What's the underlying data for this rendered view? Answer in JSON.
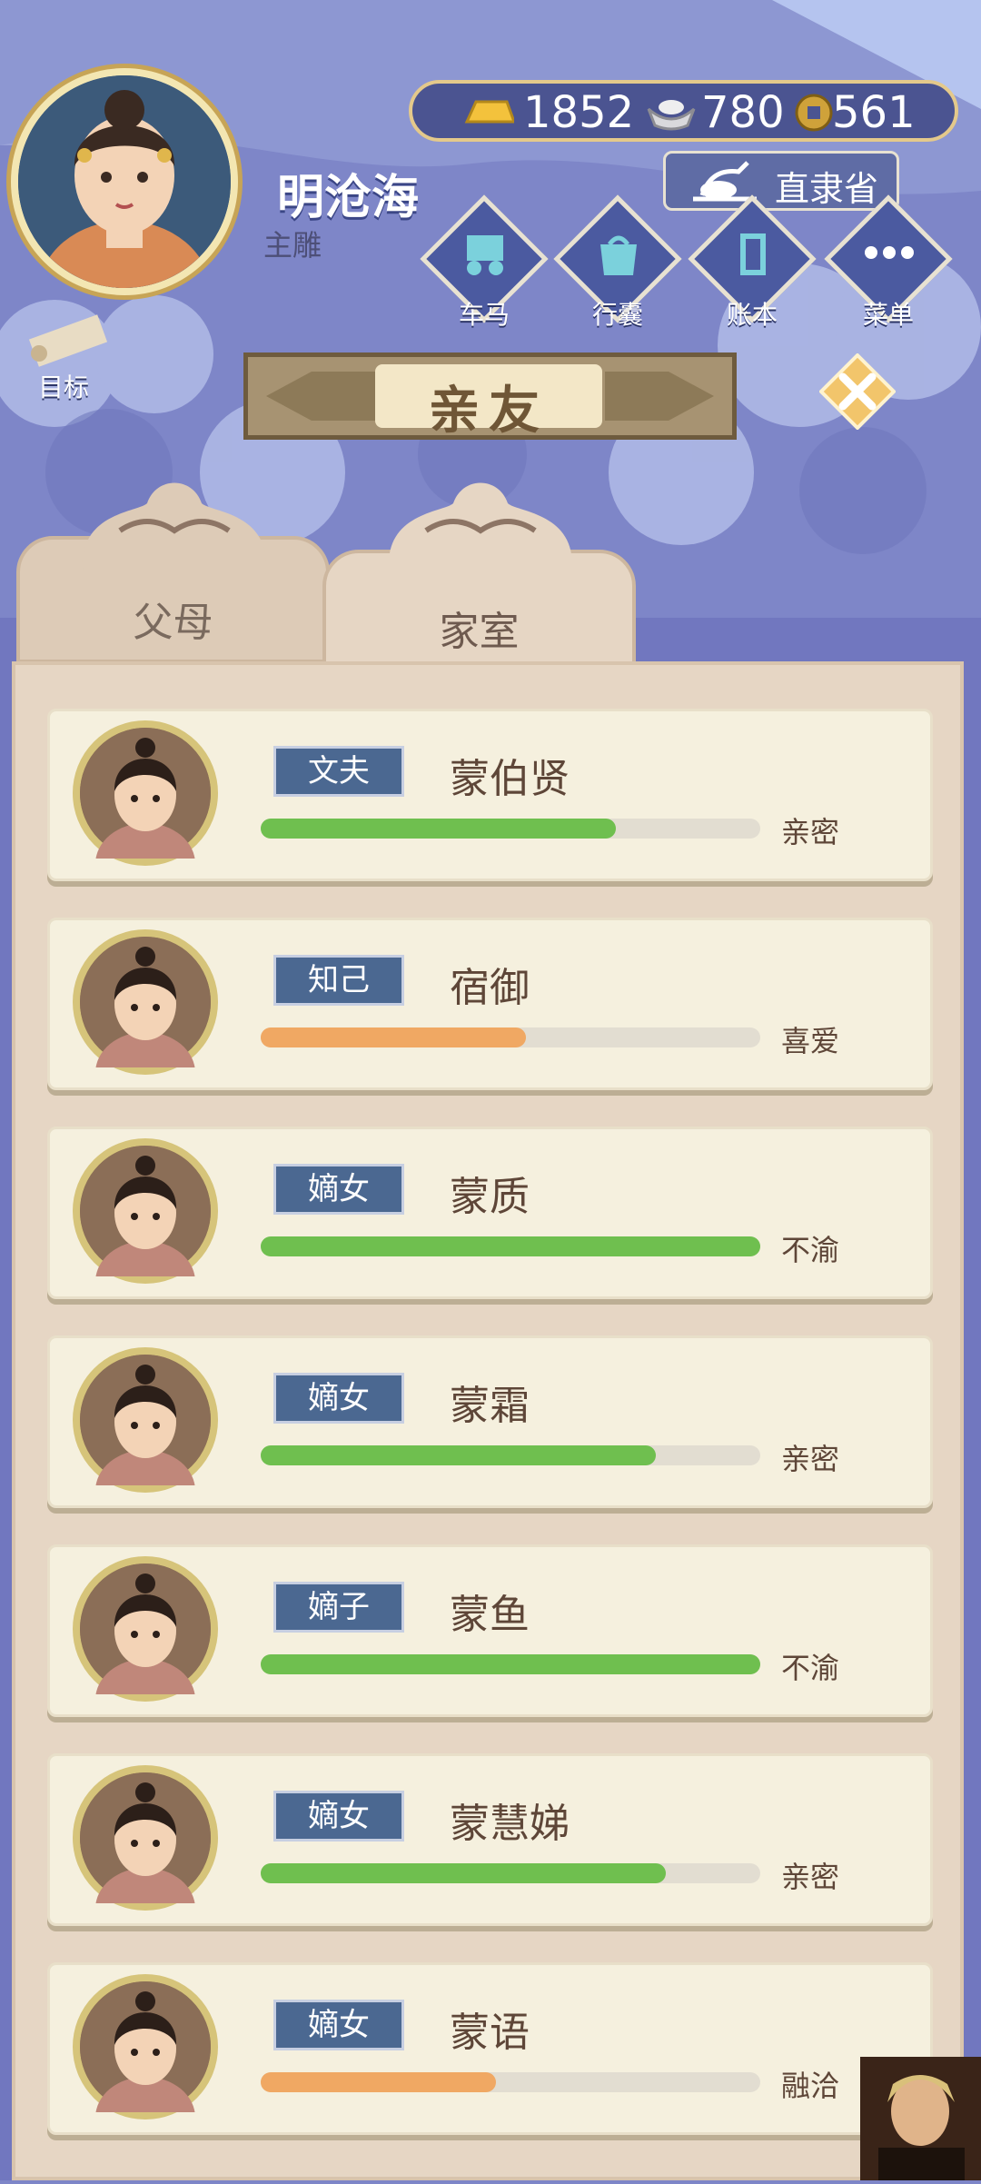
{
  "player": {
    "name": "明沧海",
    "title": "主雕"
  },
  "currencies": [
    {
      "icon": "gold-bar-icon",
      "value": "1852"
    },
    {
      "icon": "silver-ingot-icon",
      "value": "780"
    },
    {
      "icon": "coin-icon",
      "value": "561"
    }
  ],
  "location": "直隶省",
  "menu": [
    {
      "label": "车马",
      "icon": "carriage-icon"
    },
    {
      "label": "行囊",
      "icon": "bag-icon"
    },
    {
      "label": "账本",
      "icon": "ledger-icon"
    },
    {
      "label": "菜单",
      "icon": "more-icon"
    }
  ],
  "goal_label": "目标",
  "banner_title": "亲友",
  "tabs": [
    {
      "label": "父母"
    },
    {
      "label": "家室"
    }
  ],
  "members": [
    {
      "relation": "文夫",
      "name": "蒙伯贤",
      "status": "亲密",
      "affinity": 0.71,
      "color": "#6fbf4f"
    },
    {
      "relation": "知己",
      "name": "宿御",
      "status": "喜爱",
      "affinity": 0.53,
      "color": "#f0a863"
    },
    {
      "relation": "嫡女",
      "name": "蒙质",
      "status": "不渝",
      "affinity": 1.0,
      "color": "#6fbf4f"
    },
    {
      "relation": "嫡女",
      "name": "蒙霜",
      "status": "亲密",
      "affinity": 0.79,
      "color": "#6fbf4f"
    },
    {
      "relation": "嫡子",
      "name": "蒙鱼",
      "status": "不渝",
      "affinity": 1.0,
      "color": "#6fbf4f"
    },
    {
      "relation": "嫡女",
      "name": "蒙慧娣",
      "status": "亲密",
      "affinity": 0.81,
      "color": "#6fbf4f"
    },
    {
      "relation": "嫡女",
      "name": "蒙语",
      "status": "融洽",
      "affinity": 0.47,
      "color": "#f0a863"
    }
  ]
}
